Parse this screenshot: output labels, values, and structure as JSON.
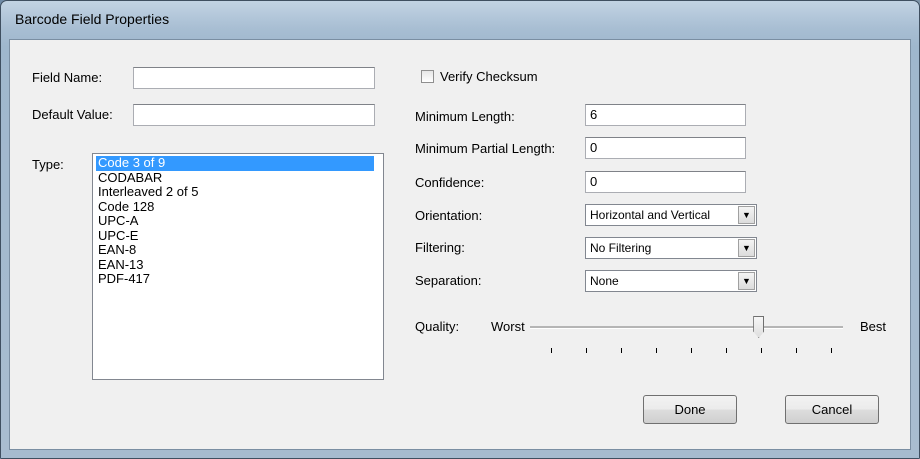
{
  "window": {
    "title": "Barcode Field Properties"
  },
  "fields": {
    "field_name": {
      "label": "Field Name:",
      "value": ""
    },
    "default_value": {
      "label": "Default Value:",
      "value": ""
    },
    "type": {
      "label": "Type:",
      "items": [
        "Code 3 of 9",
        "CODABAR",
        "Interleaved 2 of 5",
        "Code 128",
        "UPC-A",
        "UPC-E",
        "EAN-8",
        "EAN-13",
        "PDF-417"
      ],
      "selected": "Code 3 of 9"
    }
  },
  "options": {
    "verify_checksum": {
      "label": "Verify Checksum",
      "checked": false
    },
    "min_length": {
      "label": "Minimum Length:",
      "value": "6"
    },
    "min_partial_length": {
      "label": "Minimum Partial Length:",
      "value": "0"
    },
    "confidence": {
      "label": "Confidence:",
      "value": "0"
    },
    "orientation": {
      "label": "Orientation:",
      "value": "Horizontal and Vertical"
    },
    "filtering": {
      "label": "Filtering:",
      "value": "No Filtering"
    },
    "separation": {
      "label": "Separation:",
      "value": "None"
    },
    "quality": {
      "label": "Quality:",
      "min_label": "Worst",
      "max_label": "Best",
      "ticks": 9,
      "value_fraction": 0.74
    }
  },
  "buttons": {
    "done": "Done",
    "cancel": "Cancel"
  },
  "icons": {
    "dropdown": "chevron-down-icon"
  }
}
